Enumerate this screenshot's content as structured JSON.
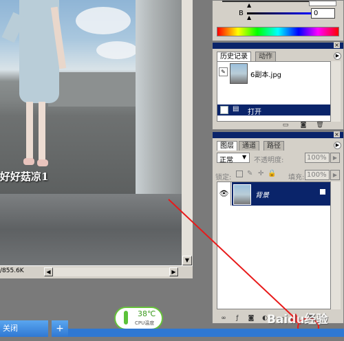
{
  "document": {
    "caption": "好好菇凉1",
    "status_size": "/855.6K",
    "scroll_left_arrow": "◀",
    "scroll_right_arrow": "▶",
    "scroll_up_arrow": "▲",
    "scroll_down_arrow": "▼"
  },
  "color_panel": {
    "b_label": "B",
    "b_value": "0"
  },
  "history_panel": {
    "tabs": [
      "历史记录",
      "动作"
    ],
    "snapshot_name": "6副本.jpg",
    "step_label": "打开"
  },
  "layers_panel": {
    "tabs": [
      "图层",
      "通道",
      "路径"
    ],
    "blend_mode": "正常",
    "opacity_label": "不透明度:",
    "opacity_value": "100%",
    "lock_label": "锁定:",
    "fill_label": "填充:",
    "fill_value": "100%",
    "layer_name": "背景"
  },
  "taskbar": {
    "close_label": "关闭",
    "add_label": "+"
  },
  "cpu_widget": {
    "temperature": "38℃",
    "label": "CPU温度"
  },
  "watermark": "Baidu经验",
  "colors": {
    "selection": "#0a246a",
    "annotation_arrow": "#e81a1a",
    "cpu_border": "#66c33a"
  }
}
